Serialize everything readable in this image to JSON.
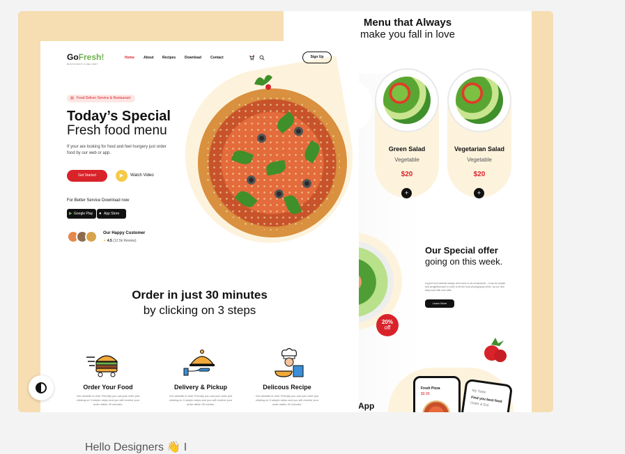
{
  "menu_page": {
    "title_line1": "Menu that Always",
    "title_line2": "make you fall in love",
    "cards": [
      {
        "name": "Green Salad",
        "category": "Vegetable",
        "price": "$20",
        "add": "+"
      },
      {
        "name": "Vegetarian Salad",
        "category": "Vegetable",
        "price": "$20",
        "add": "+"
      }
    ],
    "offer": {
      "title_bold": "Our Special offer",
      "title_regular": "going on this week.",
      "description": "A good food website design don't have to be ornamental – it can be simple and straightforward in order to let the food photography shine. try our new tasty food with new offer.",
      "button": "Learn More",
      "badge_pct": "20%",
      "badge_off": "off"
    },
    "app_label": "App",
    "phone1": {
      "title": "Fresh Pizza",
      "price": "$9.99"
    },
    "phone2": {
      "title": "Find you best food",
      "subtitle": "Order & Eat",
      "back": "My Taste"
    }
  },
  "landing": {
    "logo_go": "Go",
    "logo_fresh": "Fresh!",
    "logo_sub": "RESTAURANT & DELIVERY",
    "nav": [
      "Home",
      "About",
      "Recipes",
      "Download",
      "Contact"
    ],
    "signup": "Sign Up",
    "tag": "Food Deliver Service & Restaurant",
    "heading1": "Today’s Special",
    "heading2": "Fresh food menu",
    "lead": "If your are looking for food and feel hungery just order food by our web or app.",
    "cta": "Get Started",
    "watch": "Watch Video",
    "download_label": "For Better Service Download now",
    "google_play": "Google Play",
    "app_store": "App Store",
    "happy": "Our Happy Customer",
    "rating_value": "4.5",
    "rating_count": "(12.5k Review)",
    "steps_title1": "Order in just 30 minutes",
    "steps_title2": "by clicking on 3 steps",
    "steps": [
      {
        "title": "Order Your Food",
        "desc": "Our website is User Friendly you can just order just clicking on 3 simple steps and you will receive your order within 30 minutes."
      },
      {
        "title": "Delivery & Pickup",
        "desc": "Our website is User Friendly you can just order just clicking on 3 simple steps and you will receive your order within 30 mintes."
      },
      {
        "title": "Delicous Recipe",
        "desc": "Our website is User Friendly you can just order just clicking on 3 simple steps and you will receive your order within 30 minutes."
      }
    ]
  },
  "colors": {
    "accent": "#d8232a",
    "cream": "#fdf3dd",
    "frame": "#f6ddb2",
    "green": "#6ab04c",
    "yellow": "#f7c948"
  },
  "footer_text": "Hello Designers 👋 I",
  "icons": [
    "cart-icon",
    "search-icon",
    "play-icon",
    "star-icon",
    "theme-toggle-icon"
  ]
}
